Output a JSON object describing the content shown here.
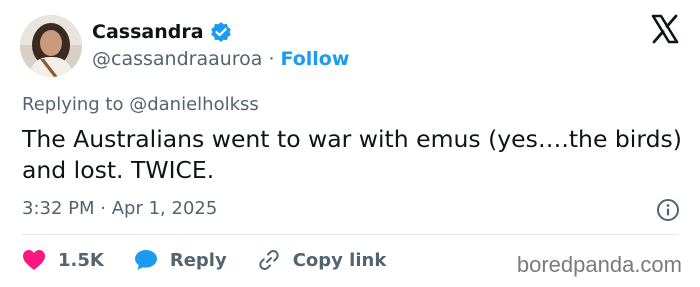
{
  "author": {
    "display_name": "Cassandra",
    "handle": "@cassandraauroa",
    "separator": "·",
    "follow_label": "Follow"
  },
  "reply": {
    "prefix": "Replying to",
    "mention": "@danielholkss"
  },
  "tweet": {
    "text": "The Australians went to war with emus (yes….the birds) and lost. TWICE.",
    "time": "3:32 PM",
    "separator": "·",
    "date": "Apr 1, 2025"
  },
  "actions": {
    "like_count": "1.5K",
    "reply_label": "Reply",
    "copy_label": "Copy link"
  },
  "watermark": "boredpanda.com",
  "colors": {
    "accent": "#1d9bf0",
    "like": "#f91880",
    "muted": "#536471",
    "text": "#0f1419"
  },
  "icons": {
    "verified": "verified-badge-icon",
    "logo": "x-logo-icon",
    "info": "info-icon",
    "like": "heart-icon",
    "reply": "speech-bubble-icon",
    "link": "link-icon"
  }
}
